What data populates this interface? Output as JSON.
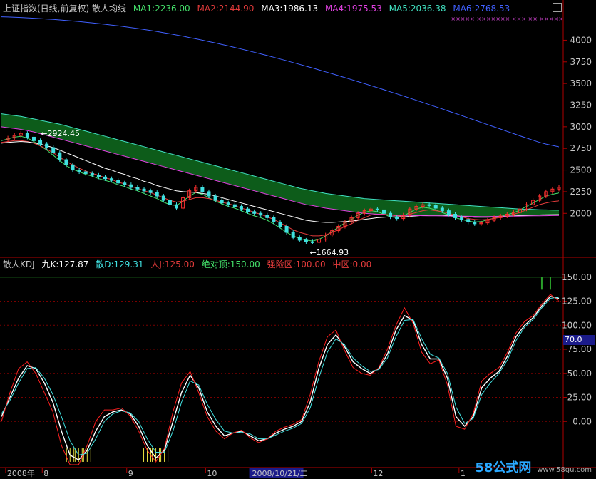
{
  "colors": {
    "ma1": "#44e06a",
    "ma2": "#e33b3b",
    "ma3": "#ffffff",
    "ma4": "#e040e0",
    "ma5": "#40e0c0",
    "ma6": "#4060ff",
    "up": "#ff3030",
    "down": "#40e0e0",
    "axis": "#b00000",
    "grid": "#7a0000",
    "kline": "#ffffff",
    "dline": "#ff2020",
    "jline": "#cccccc",
    "band": "#0d5c1a",
    "top150": "#2aa02a",
    "yellow": "#e8e040"
  },
  "top_header": {
    "title": "上证指数(日线,前复权) 散人均线",
    "ma1": "MA1:2236.00",
    "ma2": "MA2:2144.90",
    "ma3": "MA3:1986.13",
    "ma4": "MA4:1975.53",
    "ma5": "MA5:2036.38",
    "ma6": "MA6:2768.53"
  },
  "bottom_header": {
    "title": "散人KDJ",
    "k": "九K:127.87",
    "d": "散D:129.31",
    "j": "人J:125.00",
    "top": "绝对顶:150.00",
    "risk": "强险区:100.00",
    "mid": "中区:0.00"
  },
  "annotations": {
    "high": "2924.45",
    "low": "1664.93"
  },
  "x_axis": {
    "labels": [
      {
        "text": "2008年",
        "pos": 0.01
      },
      {
        "text": "8",
        "pos": 0.075
      },
      {
        "text": "9",
        "pos": 0.225
      },
      {
        "text": "10",
        "pos": 0.365
      },
      {
        "text": "2008/10/21/二",
        "pos": 0.445
      },
      {
        "text": "12",
        "pos": 0.66
      },
      {
        "text": "1",
        "pos": 0.815
      }
    ]
  },
  "watermark": {
    "logo": "58公式网",
    "url": "www.58gu.com"
  },
  "kdj_tag": "70.0",
  "x_marks": "×××××      ×××××××  ××× ××  ×××××",
  "chart_data": [
    {
      "type": "candlestick",
      "title": "上证指数(日线,前复权) 散人均线",
      "ylim": [
        1500,
        4300
      ],
      "yticks": [
        2000,
        2250,
        2500,
        2750,
        3000,
        3250,
        3500,
        3750,
        4000
      ],
      "close_path": [
        2850,
        2870,
        2900,
        2924,
        2880,
        2840,
        2800,
        2760,
        2700,
        2620,
        2560,
        2500,
        2480,
        2460,
        2440,
        2420,
        2400,
        2380,
        2350,
        2330,
        2300,
        2280,
        2260,
        2240,
        2200,
        2150,
        2100,
        2060,
        2180,
        2260,
        2300,
        2250,
        2200,
        2150,
        2120,
        2100,
        2080,
        2050,
        2020,
        2000,
        1980,
        1950,
        1900,
        1850,
        1780,
        1720,
        1690,
        1670,
        1665,
        1700,
        1750,
        1800,
        1850,
        1900,
        1950,
        2000,
        2030,
        2050,
        2040,
        2000,
        1960,
        1940,
        1980,
        2050,
        2080,
        2100,
        2090,
        2060,
        2030,
        1990,
        1950,
        1930,
        1900,
        1880,
        1890,
        1920,
        1950,
        1970,
        1990,
        2010,
        2050,
        2100,
        2150,
        2200,
        2250,
        2280,
        2300
      ],
      "series": [
        {
          "name": "MA1",
          "values": [
            2840,
            2860,
            2880,
            2890,
            2870,
            2830,
            2780,
            2730,
            2670,
            2610,
            2550,
            2510,
            2480,
            2450,
            2430,
            2400,
            2380,
            2360,
            2330,
            2310,
            2280,
            2260,
            2230,
            2200,
            2170,
            2130,
            2100,
            2090,
            2140,
            2200,
            2240,
            2220,
            2180,
            2140,
            2110,
            2080,
            2060,
            2030,
            2000,
            1970,
            1950,
            1920,
            1880,
            1830,
            1780,
            1740,
            1710,
            1690,
            1680,
            1700,
            1740,
            1790,
            1840,
            1890,
            1930,
            1980,
            2010,
            2030,
            2020,
            1990,
            1960,
            1950,
            1970,
            2010,
            2050,
            2070,
            2060,
            2040,
            2010,
            1980,
            1950,
            1930,
            1910,
            1900,
            1905,
            1925,
            1945,
            1965,
            1985,
            2005,
            2040,
            2080,
            2120,
            2160,
            2200,
            2220,
            2236
          ]
        },
        {
          "name": "MA2",
          "values": [
            2820,
            2830,
            2840,
            2840,
            2830,
            2810,
            2780,
            2740,
            2700,
            2650,
            2600,
            2560,
            2520,
            2490,
            2460,
            2440,
            2410,
            2390,
            2360,
            2340,
            2310,
            2290,
            2260,
            2240,
            2210,
            2180,
            2150,
            2130,
            2140,
            2160,
            2180,
            2180,
            2170,
            2150,
            2130,
            2110,
            2090,
            2060,
            2040,
            2010,
            1990,
            1960,
            1930,
            1890,
            1850,
            1810,
            1780,
            1760,
            1740,
            1740,
            1750,
            1780,
            1810,
            1850,
            1880,
            1920,
            1950,
            1980,
            1990,
            1990,
            1980,
            1970,
            1970,
            1990,
            2010,
            2030,
            2040,
            2030,
            2020,
            2000,
            1980,
            1960,
            1940,
            1930,
            1925,
            1930,
            1940,
            1955,
            1970,
            1990,
            2010,
            2040,
            2070,
            2100,
            2120,
            2135,
            2145
          ]
        },
        {
          "name": "MA3",
          "values": [
            2810,
            2820,
            2825,
            2830,
            2825,
            2815,
            2800,
            2780,
            2760,
            2730,
            2700,
            2670,
            2640,
            2610,
            2580,
            2550,
            2520,
            2500,
            2470,
            2450,
            2420,
            2400,
            2370,
            2350,
            2320,
            2300,
            2280,
            2260,
            2250,
            2245,
            2240,
            2230,
            2220,
            2200,
            2180,
            2160,
            2140,
            2120,
            2100,
            2080,
            2060,
            2040,
            2020,
            2000,
            1980,
            1960,
            1940,
            1920,
            1910,
            1900,
            1895,
            1895,
            1900,
            1905,
            1910,
            1920,
            1930,
            1940,
            1950,
            1955,
            1960,
            1960,
            1960,
            1965,
            1970,
            1975,
            1980,
            1980,
            1980,
            1975,
            1970,
            1965,
            1960,
            1955,
            1955,
            1955,
            1958,
            1962,
            1966,
            1970,
            1974,
            1978,
            1980,
            1982,
            1984,
            1985,
            1986
          ]
        },
        {
          "name": "MA4",
          "values": [
            3000,
            2990,
            2980,
            2970,
            2955,
            2940,
            2920,
            2900,
            2880,
            2860,
            2840,
            2820,
            2800,
            2780,
            2760,
            2740,
            2720,
            2700,
            2680,
            2660,
            2640,
            2620,
            2600,
            2580,
            2560,
            2540,
            2520,
            2500,
            2480,
            2460,
            2440,
            2420,
            2400,
            2380,
            2360,
            2340,
            2320,
            2300,
            2280,
            2260,
            2240,
            2220,
            2200,
            2180,
            2160,
            2140,
            2120,
            2100,
            2090,
            2075,
            2060,
            2050,
            2040,
            2030,
            2020,
            2010,
            2000,
            1995,
            1990,
            1985,
            1980,
            1978,
            1976,
            1975,
            1974,
            1973,
            1972,
            1971,
            1970,
            1969,
            1968,
            1967,
            1966,
            1965,
            1964,
            1964,
            1965,
            1966,
            1967,
            1968,
            1969,
            1970,
            1971,
            1972,
            1973,
            1974,
            1975
          ]
        },
        {
          "name": "MA5",
          "values": [
            3150,
            3140,
            3130,
            3120,
            3105,
            3090,
            3075,
            3060,
            3045,
            3030,
            3010,
            2990,
            2970,
            2950,
            2930,
            2910,
            2890,
            2870,
            2850,
            2830,
            2810,
            2790,
            2770,
            2750,
            2730,
            2710,
            2690,
            2670,
            2650,
            2630,
            2610,
            2590,
            2570,
            2550,
            2530,
            2510,
            2490,
            2470,
            2450,
            2430,
            2410,
            2390,
            2370,
            2350,
            2330,
            2310,
            2290,
            2275,
            2260,
            2245,
            2230,
            2220,
            2210,
            2200,
            2190,
            2180,
            2170,
            2165,
            2160,
            2155,
            2150,
            2145,
            2140,
            2135,
            2130,
            2125,
            2120,
            2115,
            2110,
            2105,
            2100,
            2095,
            2090,
            2085,
            2080,
            2075,
            2070,
            2065,
            2060,
            2055,
            2050,
            2048,
            2045,
            2042,
            2040,
            2038,
            2036
          ]
        },
        {
          "name": "MA6",
          "values": [
            4270,
            4268,
            4265,
            4262,
            4258,
            4254,
            4250,
            4245,
            4240,
            4234,
            4228,
            4222,
            4215,
            4208,
            4200,
            4192,
            4184,
            4175,
            4166,
            4156,
            4146,
            4135,
            4124,
            4112,
            4100,
            4087,
            4074,
            4060,
            4046,
            4031,
            4016,
            4000,
            3984,
            3968,
            3951,
            3934,
            3916,
            3898,
            3880,
            3861,
            3842,
            3823,
            3803,
            3783,
            3763,
            3742,
            3721,
            3700,
            3679,
            3657,
            3635,
            3613,
            3591,
            3568,
            3545,
            3522,
            3499,
            3476,
            3452,
            3428,
            3404,
            3380,
            3356,
            3331,
            3306,
            3281,
            3256,
            3231,
            3206,
            3180,
            3155,
            3129,
            3103,
            3077,
            3051,
            3025,
            2999,
            2973,
            2947,
            2921,
            2895,
            2870,
            2845,
            2820,
            2800,
            2785,
            2768
          ]
        }
      ]
    },
    {
      "type": "line",
      "title": "散人KDJ",
      "ylim": [
        -45,
        158
      ],
      "yticks": [
        0,
        25,
        50,
        75,
        100,
        125,
        150
      ],
      "reference_lines": [
        150,
        100,
        0
      ],
      "series": [
        {
          "name": "九K",
          "values": [
            5,
            25,
            45,
            58,
            55,
            40,
            20,
            -10,
            -35,
            -40,
            -30,
            -10,
            5,
            10,
            12,
            8,
            -5,
            -25,
            -38,
            -30,
            0,
            30,
            48,
            35,
            10,
            -5,
            -15,
            -12,
            -10,
            -15,
            -20,
            -18,
            -12,
            -8,
            -5,
            0,
            20,
            55,
            80,
            90,
            78,
            62,
            55,
            50,
            55,
            70,
            95,
            110,
            105,
            80,
            65,
            65,
            45,
            5,
            -5,
            5,
            35,
            45,
            52,
            68,
            88,
            100,
            108,
            120,
            130,
            127.87
          ]
        },
        {
          "name": "散D",
          "values": [
            8,
            22,
            40,
            55,
            56,
            45,
            28,
            5,
            -20,
            -35,
            -33,
            -18,
            0,
            8,
            11,
            9,
            0,
            -18,
            -32,
            -32,
            -10,
            20,
            42,
            38,
            18,
            2,
            -10,
            -12,
            -11,
            -13,
            -18,
            -18,
            -14,
            -10,
            -7,
            -2,
            14,
            45,
            72,
            86,
            80,
            66,
            58,
            52,
            54,
            66,
            88,
            105,
            106,
            86,
            70,
            66,
            50,
            15,
            -2,
            3,
            28,
            40,
            50,
            64,
            84,
            98,
            106,
            118,
            128,
            129.31
          ]
        },
        {
          "name": "人J",
          "values": [
            0,
            30,
            55,
            62,
            50,
            30,
            10,
            -25,
            -45,
            -45,
            -25,
            0,
            12,
            12,
            14,
            6,
            -10,
            -30,
            -42,
            -28,
            10,
            40,
            52,
            30,
            5,
            -10,
            -18,
            -12,
            -9,
            -17,
            -22,
            -18,
            -10,
            -6,
            -3,
            2,
            28,
            62,
            88,
            95,
            74,
            56,
            50,
            48,
            56,
            75,
            100,
            118,
            102,
            72,
            60,
            64,
            38,
            -5,
            -8,
            8,
            42,
            50,
            56,
            72,
            92,
            104,
            110,
            122,
            132,
            125
          ]
        }
      ]
    }
  ]
}
